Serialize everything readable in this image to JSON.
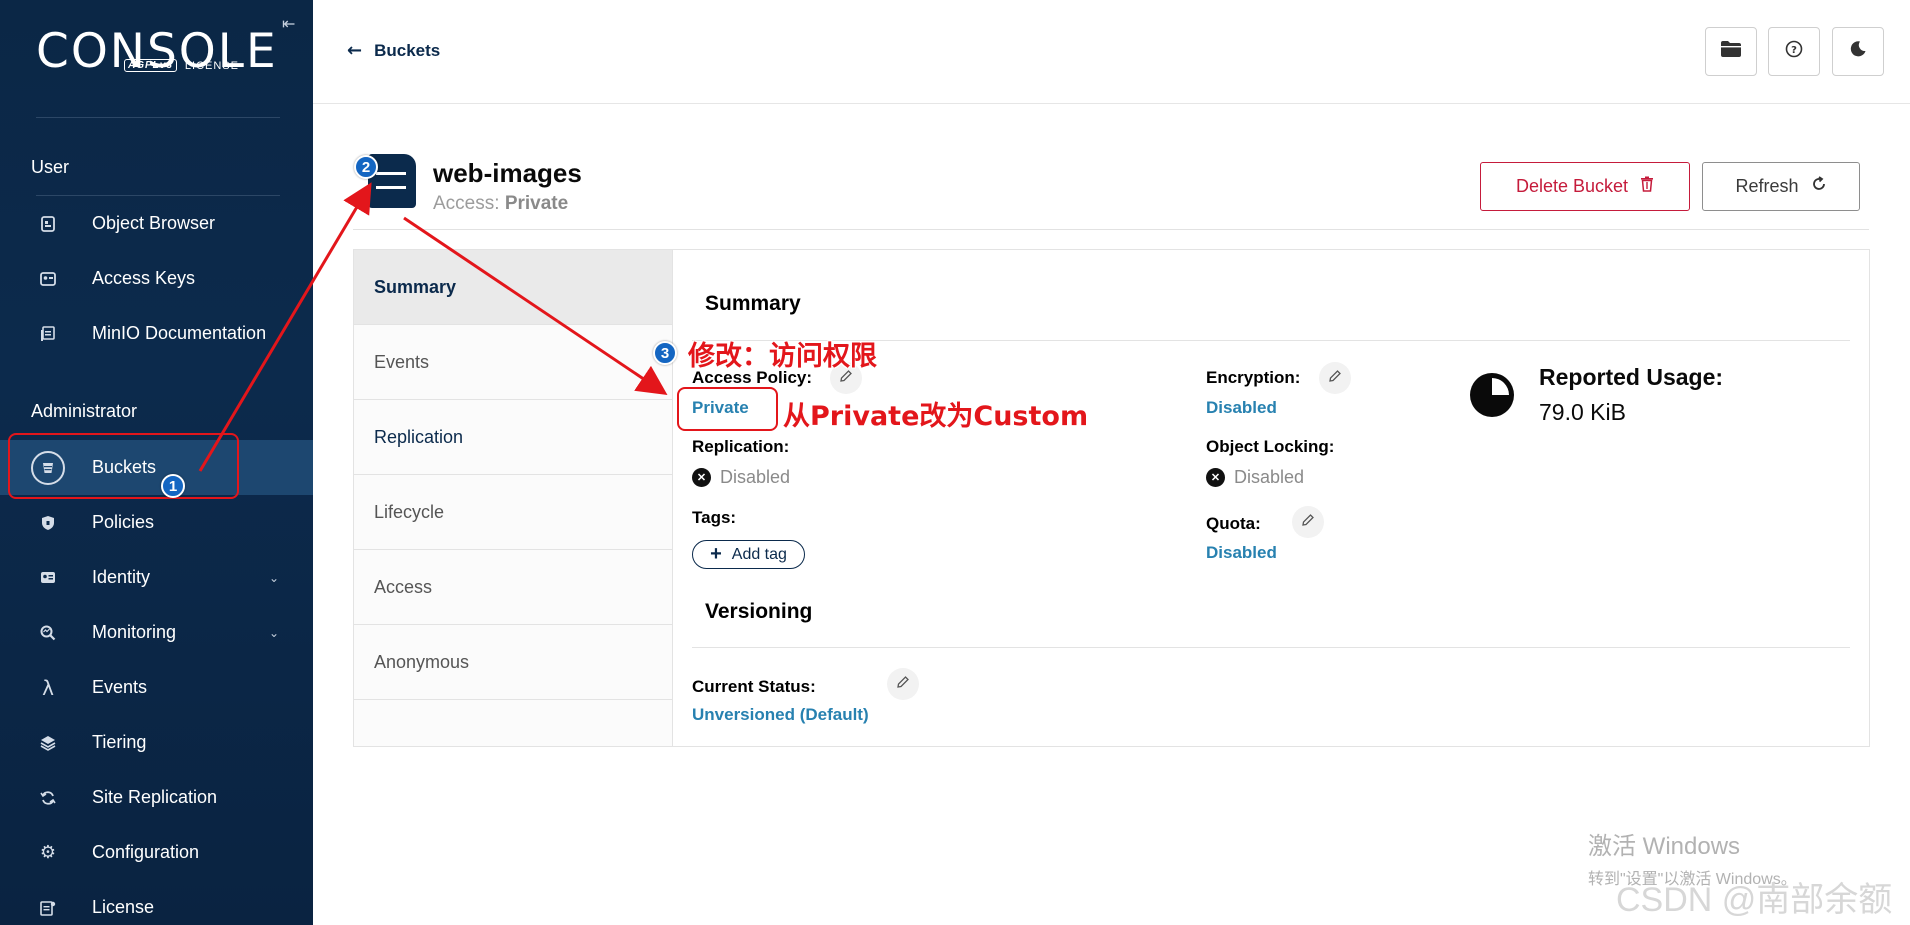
{
  "sidebar": {
    "logo_text": "CONSOLE",
    "logo_badge": "AGPLv3",
    "logo_license": "LICENSE",
    "collapse_icon": "collapse-left-icon",
    "user_section": "User",
    "admin_section": "Administrator",
    "user_items": [
      {
        "label": "Object Browser",
        "icon": "object-browser-icon"
      },
      {
        "label": "Access Keys",
        "icon": "access-keys-icon"
      },
      {
        "label": "MinIO Documentation",
        "icon": "documentation-icon"
      }
    ],
    "admin_items": [
      {
        "label": "Buckets",
        "icon": "bucket-icon",
        "active": true
      },
      {
        "label": "Policies",
        "icon": "shield-icon"
      },
      {
        "label": "Identity",
        "icon": "identity-icon",
        "expandable": true
      },
      {
        "label": "Monitoring",
        "icon": "monitoring-icon",
        "expandable": true
      },
      {
        "label": "Events",
        "icon": "lambda-icon"
      },
      {
        "label": "Tiering",
        "icon": "tiering-icon"
      },
      {
        "label": "Site Replication",
        "icon": "replication-icon"
      },
      {
        "label": "Configuration",
        "icon": "gear-icon"
      },
      {
        "label": "License",
        "icon": "license-icon"
      }
    ]
  },
  "topbar": {
    "back_label": "Buckets",
    "buttons": [
      "folder-icon",
      "help-icon",
      "dark-mode-icon"
    ]
  },
  "bucket": {
    "name": "web-images",
    "access_label": "Access:",
    "access_value": "Private",
    "delete_label": "Delete Bucket",
    "refresh_label": "Refresh"
  },
  "tabs": [
    "Summary",
    "Events",
    "Replication",
    "Lifecycle",
    "Access",
    "Anonymous"
  ],
  "active_tab": "Summary",
  "summary": {
    "title": "Summary",
    "access_policy_label": "Access Policy:",
    "access_policy_value": "Private",
    "replication_label": "Replication:",
    "replication_value": "Disabled",
    "tags_label": "Tags:",
    "add_tag_label": "Add tag",
    "encryption_label": "Encryption:",
    "encryption_value": "Disabled",
    "object_locking_label": "Object Locking:",
    "object_locking_value": "Disabled",
    "quota_label": "Quota:",
    "quota_value": "Disabled",
    "usage_label": "Reported Usage:",
    "usage_value": "79.0 KiB"
  },
  "versioning": {
    "title": "Versioning",
    "status_label": "Current Status:",
    "status_value": "Unversioned (Default)"
  },
  "annotations": {
    "badge1": "1",
    "badge2": "2",
    "badge3": "3",
    "note3": "修改：访问权限",
    "note_change": "从Private改为Custom",
    "color": "#e3161b"
  },
  "watermark": {
    "line1": "激活 Windows",
    "line2": "转到\"设置\"以激活 Windows。",
    "csdn": "CSDN @南部余额"
  }
}
